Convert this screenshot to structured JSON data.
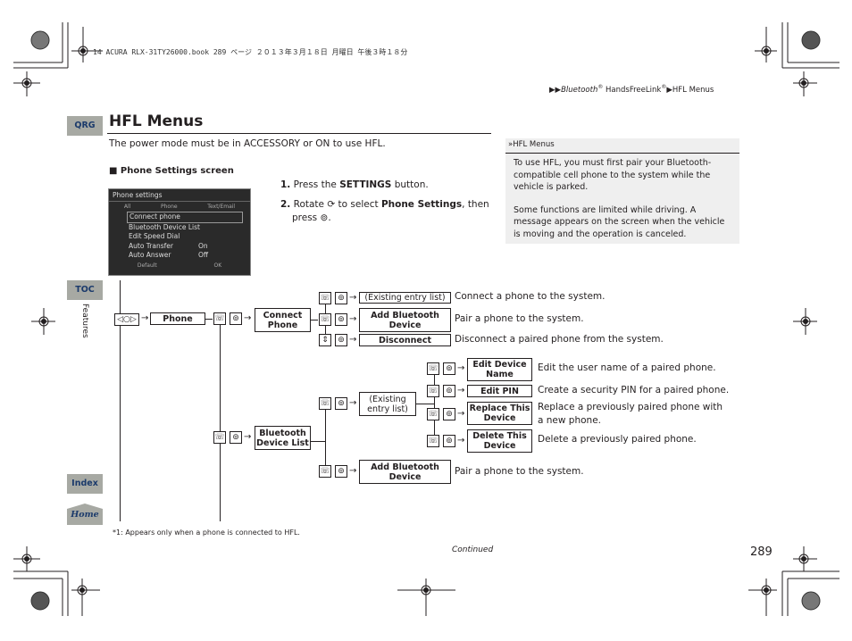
{
  "print_header": "14 ACURA RLX-31TY26000.book  289 ページ  ２０１３年３月１８日  月曜日  午後３時１８分",
  "breadcrumb": {
    "arrows": "▶▶",
    "part1": "Bluetooth",
    "reg1": "®",
    "part2": " HandsFreeLink",
    "reg2": "®",
    "sep": "▶",
    "part3": "HFL Menus"
  },
  "sidetabs": {
    "qrg": "QRG",
    "toc": "TOC",
    "section": "Features",
    "index": "Index",
    "home": "Home"
  },
  "page": {
    "title": "HFL Menus",
    "intro": "The power mode must be in ACCESSORY or ON to use HFL.",
    "subheading": "■ Phone Settings screen",
    "step1_num": "1.",
    "step1_a": " Press the ",
    "step1_b": "SETTINGS",
    "step1_c": " button.",
    "step2_num": "2.",
    "step2_a": " Rotate ",
    "step2_b": " to select ",
    "step2_c": "Phone Settings",
    "step2_d": ", then",
    "step2_e": "press ",
    "step2_f": ".",
    "footnote": "*1: Appears only when a phone is connected to HFL.",
    "continued": "Continued",
    "page_number": "289"
  },
  "note": {
    "heading": "HFL Menus",
    "p1": "To use HFL, you must first pair your Bluetooth-compatible cell phone to the system while the vehicle is parked.",
    "p2": "Some functions are limited while driving. A message appears on the screen when the vehicle is moving and the operation is canceled."
  },
  "screen": {
    "title": "Phone settings",
    "tabs": [
      "All",
      "Phone",
      "Text/Email"
    ],
    "items": [
      {
        "label": "Connect phone",
        "value": ""
      },
      {
        "label": "Bluetooth Device List",
        "value": ""
      },
      {
        "label": "Edit Speed Dial",
        "value": ""
      },
      {
        "label": "Auto Transfer",
        "value": "On"
      },
      {
        "label": "Auto Answer",
        "value": "Off"
      }
    ],
    "footer": [
      "Default",
      "OK"
    ]
  },
  "flow": {
    "phone": "Phone",
    "connect_phone": "Connect Phone",
    "existing_list_1": "(Existing entry list)",
    "add_bt_1": "Add Bluetooth Device",
    "disconnect": "Disconnect",
    "bt_device_list": "Bluetooth Device List",
    "existing_list_2": "(Existing entry list)",
    "edit_device_name": "Edit Device Name",
    "edit_pin": "Edit PIN",
    "replace_device": "Replace This Device",
    "delete_device": "Delete This Device",
    "add_bt_2": "Add Bluetooth Device",
    "desc_connect": "Connect a phone to the system.",
    "desc_pair_1": "Pair a phone to the system.",
    "desc_disconnect": "Disconnect a paired phone from the system.",
    "desc_edit_name": "Edit the user name of a paired phone.",
    "desc_edit_pin": "Create a security PIN for a paired phone.",
    "desc_replace": "Replace a previously paired phone with a new phone.",
    "desc_delete": "Delete a previously paired phone.",
    "desc_pair_2": "Pair a phone to the system."
  },
  "colors": {
    "tab_bg": "#a7a9a3",
    "tab_text": "#1b3a6b",
    "note_bg": "#efefef"
  }
}
